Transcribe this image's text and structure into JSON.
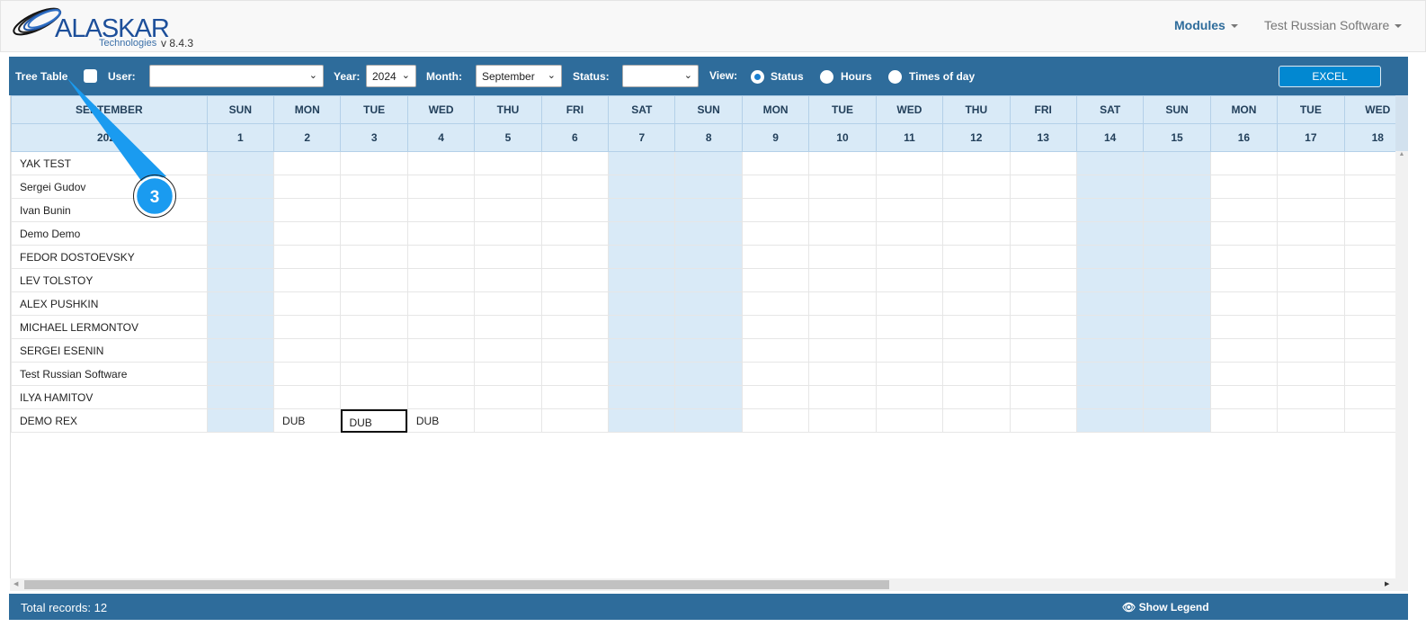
{
  "header": {
    "brand": "ALASKAR",
    "tagline": "Technologies",
    "version": "v 8.4.3",
    "modules": "Modules",
    "user_menu": "Test Russian Software"
  },
  "toolbar": {
    "tree_table": "Tree Table",
    "user_label": "User:",
    "user_value": "",
    "year_label": "Year:",
    "year_value": "2024",
    "month_label": "Month:",
    "month_value": "September",
    "status_label": "Status:",
    "status_value": "",
    "view_label": "View:",
    "view_options": [
      {
        "label": "Status",
        "selected": true
      },
      {
        "label": "Hours",
        "selected": false
      },
      {
        "label": "Times of day",
        "selected": false
      }
    ],
    "excel": "EXCEL"
  },
  "table": {
    "month": "SEPTEMBER",
    "year": "2024",
    "days": [
      {
        "d": "1",
        "dow": "SUN",
        "we": true
      },
      {
        "d": "2",
        "dow": "MON"
      },
      {
        "d": "3",
        "dow": "TUE"
      },
      {
        "d": "4",
        "dow": "WED"
      },
      {
        "d": "5",
        "dow": "THU"
      },
      {
        "d": "6",
        "dow": "FRI"
      },
      {
        "d": "7",
        "dow": "SAT",
        "we": true
      },
      {
        "d": "8",
        "dow": "SUN",
        "we": true
      },
      {
        "d": "9",
        "dow": "MON"
      },
      {
        "d": "10",
        "dow": "TUE"
      },
      {
        "d": "11",
        "dow": "WED"
      },
      {
        "d": "12",
        "dow": "THU"
      },
      {
        "d": "13",
        "dow": "FRI"
      },
      {
        "d": "14",
        "dow": "SAT",
        "we": true
      },
      {
        "d": "15",
        "dow": "SUN",
        "we": true
      },
      {
        "d": "16",
        "dow": "MON"
      },
      {
        "d": "17",
        "dow": "TUE"
      },
      {
        "d": "18",
        "dow": "WED"
      }
    ],
    "rows": [
      {
        "name": "YAK TEST",
        "cells": {}
      },
      {
        "name": "Sergei Gudov",
        "cells": {}
      },
      {
        "name": "Ivan Bunin",
        "cells": {}
      },
      {
        "name": "Demo Demo",
        "cells": {}
      },
      {
        "name": "FEDOR DOSTOEVSKY",
        "cells": {}
      },
      {
        "name": "LEV TOLSTOY",
        "cells": {}
      },
      {
        "name": "ALEX PUSHKIN",
        "cells": {}
      },
      {
        "name": "MICHAEL LERMONTOV",
        "cells": {}
      },
      {
        "name": "SERGEI ESENIN",
        "cells": {}
      },
      {
        "name": "Test Russian Software",
        "cells": {}
      },
      {
        "name": "ILYA HAMITOV",
        "cells": {}
      },
      {
        "name": "DEMO REX",
        "cells": {
          "2": "DUB",
          "3": "DUB",
          "4": "DUB"
        },
        "selected": "3"
      }
    ]
  },
  "footer": {
    "total": "Total records: 12",
    "legend": "Show Legend"
  },
  "callout": {
    "number": "3"
  },
  "colors": {
    "bar": "#2e6c9b",
    "header_cell": "#d9eaf7",
    "excel": "#0288d1",
    "callout": "#1a9bf0"
  }
}
